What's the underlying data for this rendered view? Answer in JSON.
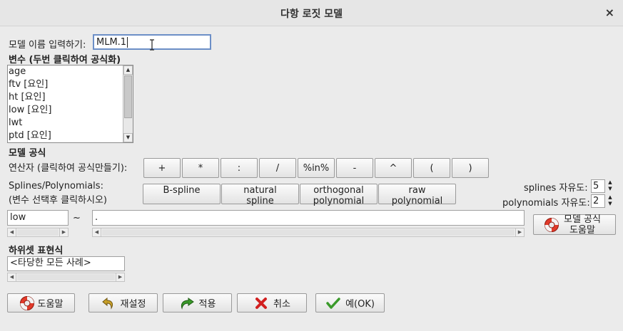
{
  "window": {
    "title": "다항 로짓 모델",
    "close_glyph": "×"
  },
  "model_name": {
    "label": "모델 이름 입력하기:",
    "value": "MLM.1"
  },
  "variables": {
    "heading": "변수 (두번 클릭하여 공식화)",
    "items": [
      "age",
      "ftv [요인]",
      "ht [요인]",
      "low [요인]",
      "lwt",
      "ptd [요인]"
    ]
  },
  "formula_section": {
    "heading": "모델 공식"
  },
  "operators": {
    "label": "연산자 (클릭하여 공식만들기):",
    "buttons": [
      "+",
      "*",
      ":",
      "/",
      "%in%",
      "-",
      "^",
      "(",
      ")"
    ]
  },
  "splines": {
    "label_line1": "Splines/Polynomials:",
    "label_line2": "(변수 선택후 클릭하시오)",
    "buttons": [
      {
        "line1": "B-spline",
        "line2": ""
      },
      {
        "line1": "natural",
        "line2": "spline"
      },
      {
        "line1": "orthogonal",
        "line2": "polynomial"
      },
      {
        "line1": "raw",
        "line2": "polynomial"
      }
    ],
    "df_splines_label": "splines 자유도:",
    "df_splines_value": "5",
    "df_poly_label": "polynomials 자유도:",
    "df_poly_value": "2"
  },
  "formula": {
    "lhs": "low",
    "tilde": "~",
    "rhs": "."
  },
  "formula_help_button": {
    "line1": "모델 공식",
    "line2": "도움말"
  },
  "subset": {
    "heading": "하위셋 표현식",
    "value": "<타당한 모든 사례>"
  },
  "buttons": {
    "help": "도움말",
    "reset": "재설정",
    "apply": "적용",
    "cancel": "취소",
    "ok": "예(OK)"
  },
  "colors": {
    "focus_border": "#6c8fc7",
    "ok_check": "#3a9a2a",
    "cancel_x": "#d22020",
    "arrow_green": "#3a9a2a",
    "reset_arrow": "#c8a028"
  }
}
